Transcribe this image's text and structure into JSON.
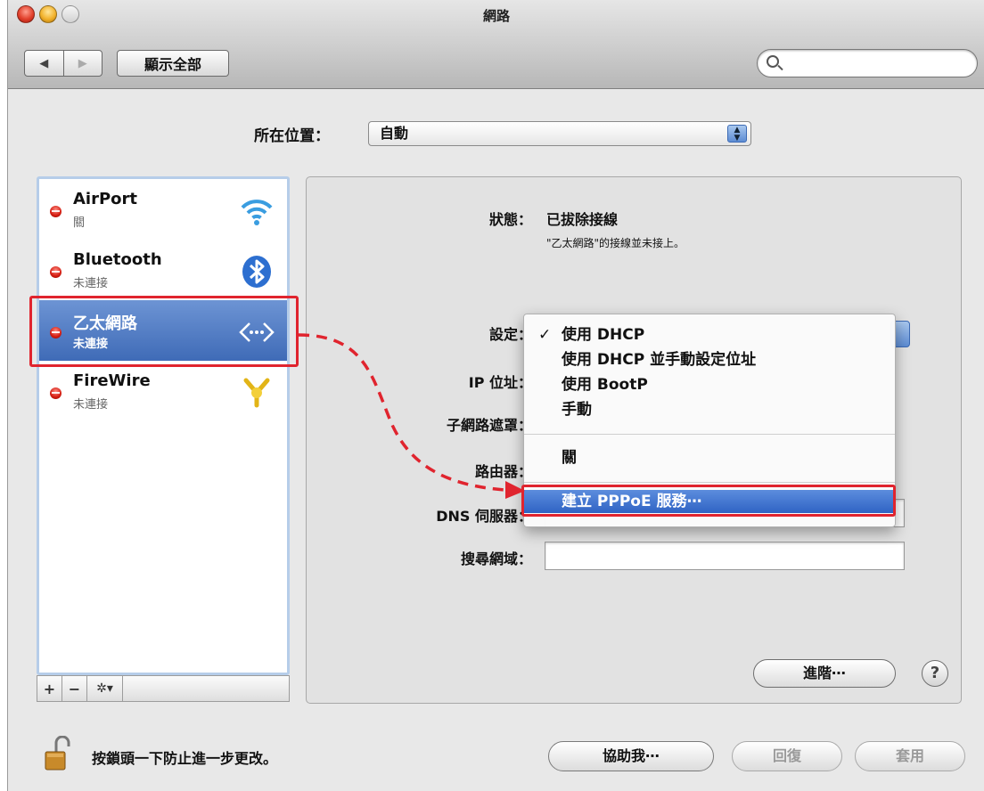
{
  "window": {
    "title": "網路"
  },
  "toolbar": {
    "back_icon": "◀",
    "forward_icon": "▶",
    "show_all_label": "顯示全部",
    "search_placeholder": ""
  },
  "location": {
    "label": "所在位置：",
    "value": "自動"
  },
  "services": [
    {
      "name": "AirPort",
      "status": "關",
      "icon": "wifi-icon",
      "selected": false
    },
    {
      "name": "Bluetooth",
      "status": "未連接",
      "icon": "bluetooth-icon",
      "selected": false
    },
    {
      "name": "乙太網路",
      "status": "未連接",
      "icon": "ethernet-icon",
      "selected": true
    },
    {
      "name": "FireWire",
      "status": "未連接",
      "icon": "firewire-icon",
      "selected": false
    }
  ],
  "service_bar": {
    "add_label": "+",
    "remove_label": "−",
    "gear_label": "✲▾"
  },
  "detail": {
    "status_label": "狀態：",
    "status_value": "已拔除接線",
    "status_description": "\"乙太網路\"的接線並未接上。",
    "configure_label": "設定：",
    "ip_label": "IP 位址：",
    "subnet_label": "子網路遮罩：",
    "router_label": "路由器：",
    "dns_label": "DNS 伺服器：",
    "search_domains_label": "搜尋網域：",
    "advanced_label": "進階⋯",
    "help_label": "?"
  },
  "configure_menu": {
    "checkmark": "✓",
    "items": [
      "使用 DHCP",
      "使用 DHCP 並手動設定位址",
      "使用 BootP",
      "手動"
    ],
    "off_item": "關",
    "pppoe_item": "建立 PPPoE 服務⋯"
  },
  "footer": {
    "lock_text": "按鎖頭一下防止進一步更改。",
    "assist_label": "協助我⋯",
    "revert_label": "回復",
    "apply_label": "套用"
  },
  "colors": {
    "highlight_red": "#e0242e",
    "selection_blue": "#3f6bb7"
  }
}
